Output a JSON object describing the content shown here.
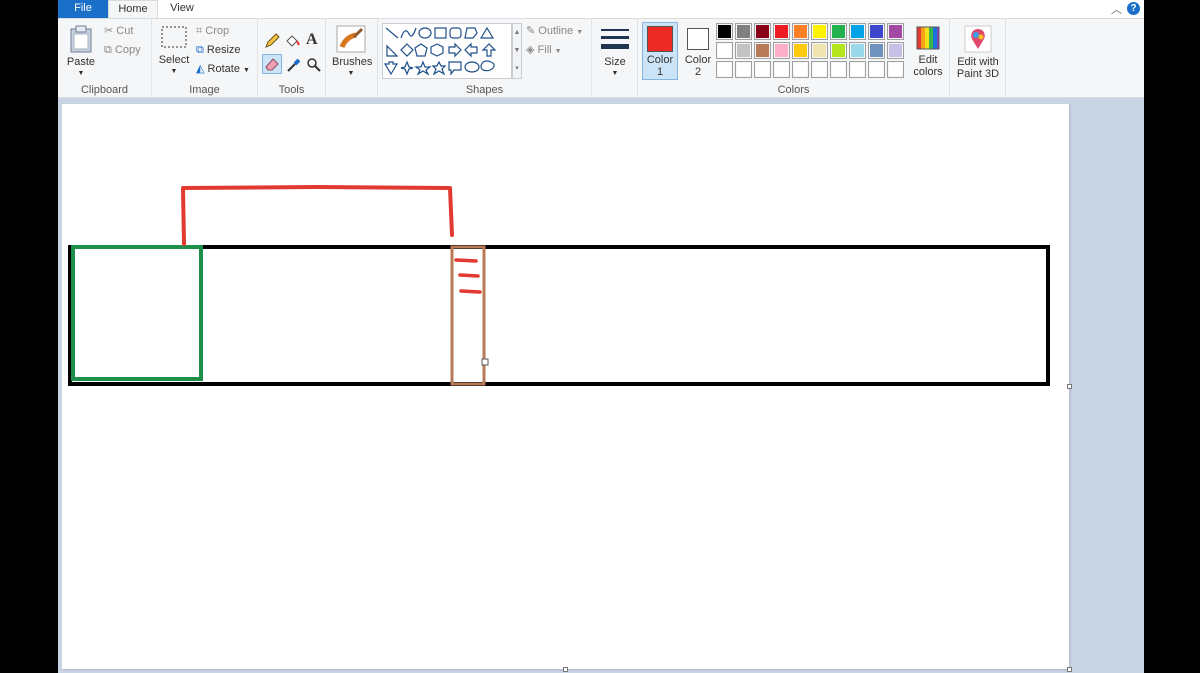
{
  "tabs": {
    "file": "File",
    "home": "Home",
    "view": "View"
  },
  "clipboard": {
    "paste": "Paste",
    "cut": "Cut",
    "copy": "Copy",
    "label": "Clipboard"
  },
  "image": {
    "select": "Select",
    "crop": "Crop",
    "resize": "Resize",
    "rotate": "Rotate",
    "label": "Image"
  },
  "tools": {
    "label": "Tools",
    "text_glyph": "A"
  },
  "brushes": {
    "label": "Brushes"
  },
  "shapes": {
    "outline": "Outline",
    "fill": "Fill",
    "label": "Shapes"
  },
  "size": {
    "label": "Size"
  },
  "colors": {
    "color1_label": "Color",
    "color1_num": "1",
    "color2_label": "Color",
    "color2_num": "2",
    "color1_value": "#ee2a24",
    "color2_value": "#ffffff",
    "edit_line1": "Edit",
    "edit_line2": "colors",
    "label": "Colors",
    "palette_row1": [
      "#000000",
      "#7f7f7f",
      "#880015",
      "#ed1c24",
      "#ff7f27",
      "#fff200",
      "#22b14c",
      "#00a2e8",
      "#3f48cc",
      "#a349a4"
    ],
    "palette_row2": [
      "#ffffff",
      "#c3c3c3",
      "#b97a57",
      "#ffaec9",
      "#ffc90e",
      "#efe4b0",
      "#b5e61d",
      "#99d9ea",
      "#7092be",
      "#c8bfe7"
    ],
    "palette_row3": [
      "#ffffff",
      "#ffffff",
      "#ffffff",
      "#ffffff",
      "#ffffff",
      "#ffffff",
      "#ffffff",
      "#ffffff",
      "#ffffff",
      "#ffffff"
    ]
  },
  "paint3d": {
    "line1": "Edit with",
    "line2": "Paint 3D"
  },
  "drawing": {
    "outer_rect_color": "#000000",
    "green_rect_color": "#1e8f4a",
    "brown_rect_color": "#b97a57",
    "red_stroke_color": "#e23a31"
  }
}
